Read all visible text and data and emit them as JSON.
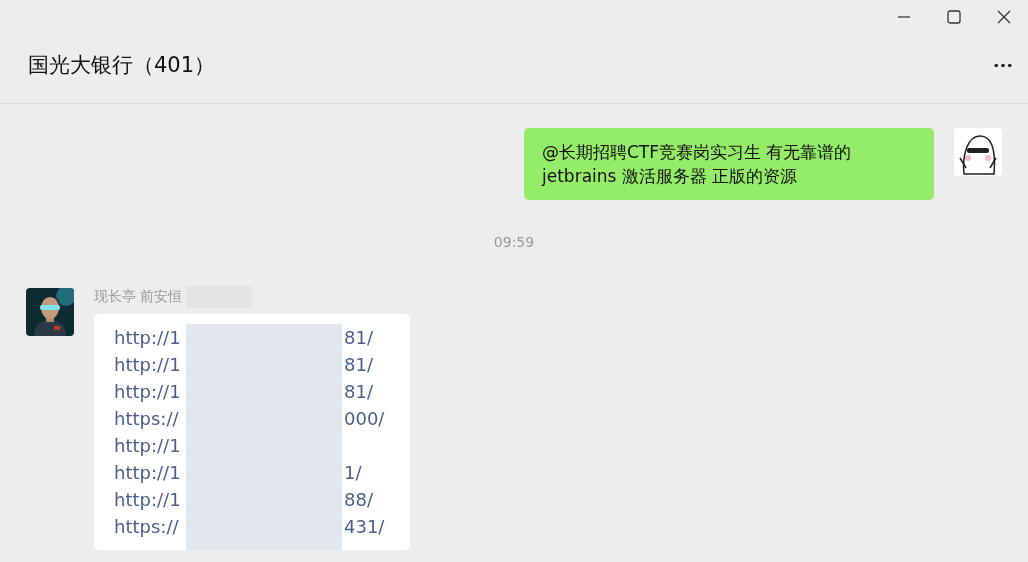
{
  "chat": {
    "title": "国光大银行（401）"
  },
  "messages": [
    {
      "kind": "outgoing",
      "text": "@长期招聘CTF竞赛岗实习生 有无靠谱的 jetbrains 激活服务器 正版的资源"
    },
    {
      "kind": "time",
      "text": "09:59"
    },
    {
      "kind": "incoming",
      "sender": "现长亭 前安恒",
      "links": [
        {
          "prefix": "http://1",
          "suffix": "81/"
        },
        {
          "prefix": "http://1",
          "suffix": "81/"
        },
        {
          "prefix": "http://1",
          "suffix": "81/"
        },
        {
          "prefix": "https://",
          "suffix": "000/"
        },
        {
          "prefix": "http://1"
        },
        {
          "prefix": "http://1",
          "suffix": "1/"
        },
        {
          "prefix": "http://1",
          "suffix": "88/"
        },
        {
          "prefix": "https://",
          "suffix": "431/"
        }
      ]
    }
  ]
}
